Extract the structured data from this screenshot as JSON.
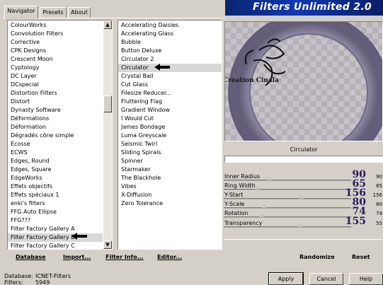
{
  "tabs": [
    {
      "label": "Navigator",
      "active": true
    },
    {
      "label": "Presets",
      "active": false
    },
    {
      "label": "About",
      "active": false
    }
  ],
  "banner": {
    "title": "Filters Unlimited 2.0"
  },
  "categories": {
    "items": [
      "ColourWorks",
      "Convolution Filters",
      "Corrective",
      "CPK Designs",
      "Crescent Moon",
      "Cyptology",
      "DC Layer",
      "DCspecial",
      "Distortion Filters",
      "Distort",
      "Dynasty Software",
      "Déformations",
      "Déformation",
      "Dégradés cône simple",
      "Ecosse",
      "ECWS",
      "Edges, Round",
      "Edges, Square",
      "EdgeWorks",
      "Effets objectifs",
      "Effets spéciaux 1",
      "enki's filters",
      "FFG Auto Ellipse",
      "FFG???",
      "Filter Factory Gallery A",
      "Filter Factory Gallery B",
      "Filter Factory Gallery C"
    ],
    "selected": "Filter Factory Gallery B"
  },
  "filters": {
    "items": [
      "Accelerating Daisies",
      "Accelerating Glass",
      "Bubble",
      "Button Deluxe",
      "Circulator 2",
      "Circulator",
      "Crystal Ball",
      "Cut Glass",
      "Filesize Reducer...",
      "Fluttering Flag",
      "Gradient Window",
      "I Would Cut",
      "James Bondage",
      "Luma Greyscale",
      "Seismic Twirl",
      "Sliding Spirals",
      "Spinner",
      "Starmaker",
      "The Blackhole",
      "Vibes",
      "X-Diffusion",
      "Zero Tolerance"
    ],
    "selected": "Circulator"
  },
  "preview": {
    "watermark": "©Creation Cinala"
  },
  "current_filter": "Circulator",
  "sliders": [
    {
      "label": "Inner Radius",
      "value": "90",
      "small": "90",
      "level": 90
    },
    {
      "label": "Ring Width",
      "value": "65",
      "small": "65",
      "level": 65
    },
    {
      "label": "Y-Start",
      "value": "156",
      "small": "156",
      "level": 156
    },
    {
      "label": "Y-Scale",
      "value": "80",
      "small": "80",
      "level": 80
    },
    {
      "label": "Rotation",
      "value": "74",
      "small": "74",
      "level": 74
    },
    {
      "label": "Transparency",
      "value": "155",
      "small": "55",
      "level": 155
    }
  ],
  "bottom_links": {
    "database": "Database",
    "import": "Import...",
    "filter_info": "Filter Info...",
    "editor": "Editor...",
    "randomize": "Randomize",
    "reset": "Reset"
  },
  "info": {
    "database_label": "Database:",
    "database_value": "ICNET-Filters",
    "filters_label": "Filters:",
    "filters_value": "5949"
  },
  "buttons": {
    "apply": "Apply",
    "cancel": "Cancel",
    "help": "Help"
  },
  "colors": {
    "banner": "#1238b0",
    "arrow": "#000000",
    "slider_value": "#2a1a5a"
  }
}
